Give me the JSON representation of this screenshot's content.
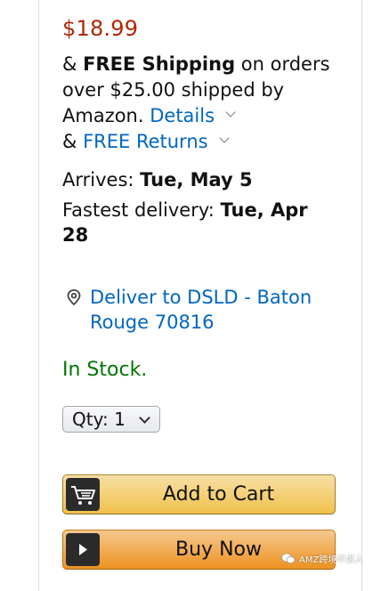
{
  "buybox": {
    "price": "$18.99",
    "shipping_prefix": "& ",
    "shipping_bold": "FREE Shipping",
    "shipping_rest": " on orders over $25.00 shipped by Amazon. ",
    "details_link": "Details",
    "returns_prefix": "& ",
    "returns_link": "FREE Returns",
    "arrives_label": "Arrives: ",
    "arrives_value": "Tue, May 5",
    "fastest_label": "Fastest delivery: ",
    "fastest_value": "Tue, Apr 28",
    "deliver_to": "Deliver to DSLD - Baton Rouge 70816",
    "stock_status": "In Stock.",
    "qty_label": "Qty: ",
    "qty_value": "1",
    "add_to_cart_label": "Add to Cart",
    "buy_now_label": "Buy Now"
  },
  "watermark": {
    "text": "AMZ跨境不求人"
  },
  "colors": {
    "price": "#B12704",
    "link": "#0066C0",
    "in_stock": "#007600",
    "add_to_cart": "#F0C14B",
    "buy_now": "#ED9220"
  },
  "icons": {
    "location": "location-pin-icon",
    "cart": "cart-icon",
    "buy_now": "play-icon",
    "chevron": "chevron-down-icon"
  }
}
